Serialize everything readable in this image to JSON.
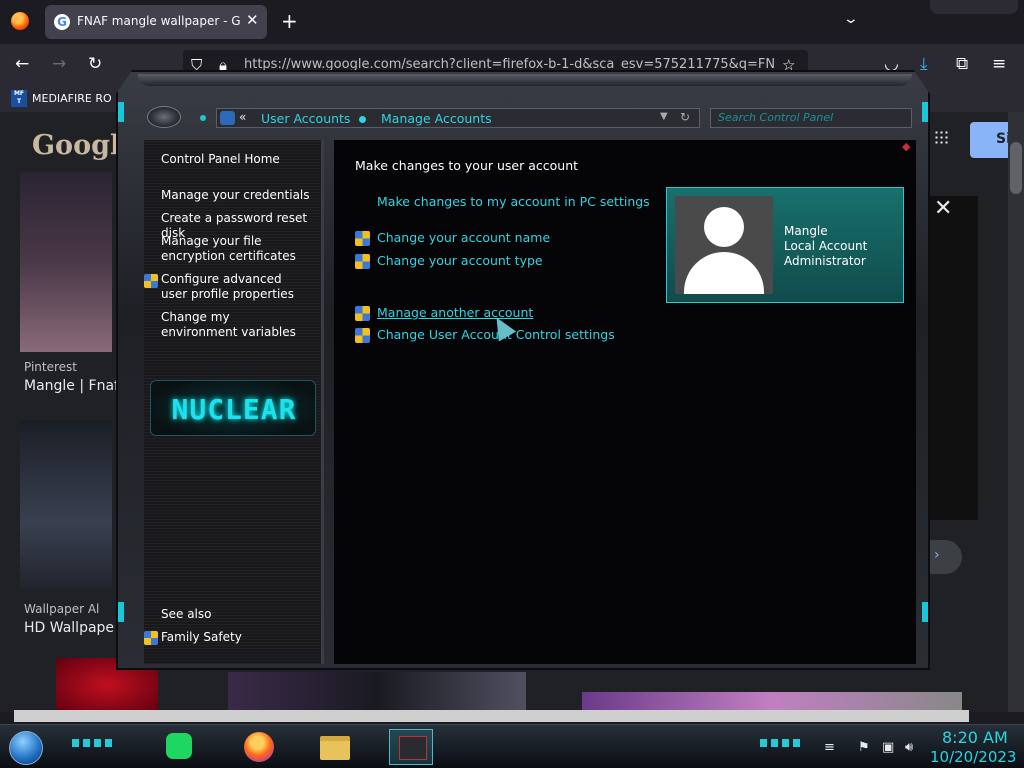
{
  "browser": {
    "tab_title": "FNAF mangle wallpaper - Google Search",
    "tab_close": "✕",
    "new_tab": "+",
    "url": "https://www.google.com/search?client=firefox-b-1-d&sca_esv=575211775&q=FNAF+",
    "bookmark_label": "MEDIAFIRE RO",
    "bookmark_icon_text": "MF T"
  },
  "google": {
    "logo": "Google",
    "sign_in": "Si",
    "results": [
      {
        "source": "Pinterest",
        "title": "Mangle | Fnaf,"
      },
      {
        "source": "Wallpaper Al",
        "title": "HD Wallpape"
      }
    ],
    "close": "✕"
  },
  "control_panel": {
    "breadcrumb_root": "User Accounts",
    "breadcrumb_current": "Manage Accounts",
    "search_placeholder": "Search Control Panel",
    "nav": {
      "home": "Control Panel Home",
      "links": [
        "Manage your credentials",
        "Create a password reset disk",
        "Manage your file encryption certificates",
        "Configure advanced user profile properties",
        "Change my environment variables"
      ],
      "see_also": "See also",
      "family_safety": "Family Safety"
    },
    "logo_text": "NUCLEAR",
    "heading": "Make changes to your user account",
    "pc_settings_link": "Make changes to my account in PC settings",
    "tasks": [
      "Change your account name",
      "Change your account type",
      "Manage another account",
      "Change User Account Control settings"
    ],
    "user": {
      "name": "Mangle",
      "account_kind": "Local Account",
      "role": "Administrator"
    }
  },
  "taskbar": {
    "time": "8:20 AM",
    "date": "10/20/2023"
  },
  "colors": {
    "accent": "#2fd4e4",
    "panel_bg": "#050507",
    "user_card": "#18706c"
  }
}
